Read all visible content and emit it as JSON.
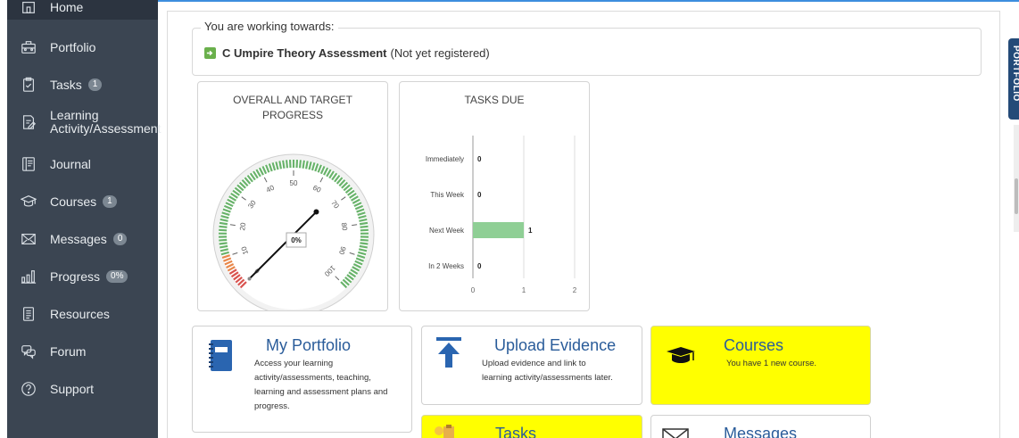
{
  "sidebar": {
    "items": [
      {
        "label": "Home",
        "icon": "home-icon",
        "badge": ""
      },
      {
        "label": "Portfolio",
        "icon": "briefcase-icon",
        "badge": ""
      },
      {
        "label": "Tasks",
        "icon": "clipboard-icon",
        "badge": "1"
      },
      {
        "label": "Learning",
        "label2": "Activity/Assessment",
        "icon": "edit-doc-icon",
        "badge": ""
      },
      {
        "label": "Journal",
        "icon": "journal-icon",
        "badge": ""
      },
      {
        "label": "Courses",
        "icon": "graduation-cap-icon",
        "badge": "1"
      },
      {
        "label": "Messages",
        "icon": "envelope-icon",
        "badge": "0"
      },
      {
        "label": "Progress",
        "icon": "bar-chart-icon",
        "badge": "0%"
      },
      {
        "label": "Resources",
        "icon": "resources-icon",
        "badge": ""
      },
      {
        "label": "Forum",
        "icon": "chat-icon",
        "badge": ""
      },
      {
        "label": "Support",
        "icon": "question-icon",
        "badge": ""
      }
    ]
  },
  "working": {
    "legend": "You are working towards:",
    "course": "C Umpire Theory Assessment",
    "status": "(Not yet registered)"
  },
  "right_tab": {
    "label": "PORTFOLIO"
  },
  "gauge": {
    "title_line1": "OVERALL AND TARGET",
    "title_line2": "PROGRESS",
    "value_label": "0%",
    "progress": 0,
    "ticks": [
      "0",
      "10",
      "20",
      "30",
      "40",
      "50",
      "60",
      "70",
      "80",
      "90",
      "100"
    ],
    "zone_colors": {
      "green": "#69b36b",
      "orange": "#e8874a",
      "red": "#d9534f"
    }
  },
  "tasks_due": {
    "title": "TASKS DUE"
  },
  "chart_data": {
    "type": "bar",
    "orientation": "horizontal",
    "title": "TASKS DUE",
    "categories": [
      "Immediately",
      "This Week",
      "Next Week",
      "In 2 Weeks"
    ],
    "values": [
      0,
      0,
      1,
      0
    ],
    "value_labels": [
      "0",
      "0",
      "1",
      "0"
    ],
    "xticks": [
      "0",
      "1",
      "2"
    ],
    "xlim": [
      0,
      2
    ],
    "bar_color": "#8fcf95",
    "grid": true
  },
  "tiles": [
    {
      "title": "My Portfolio",
      "icon": "notebook-icon",
      "desc": [
        "Access your learning",
        "activity/assessments, teaching,",
        "learning and assessment plans and",
        "progress."
      ]
    },
    {
      "title": "Upload Evidence",
      "icon": "upload-arrow-icon",
      "desc": [
        "Upload evidence and link to",
        "learning activity/assessments later."
      ]
    },
    {
      "title": "Courses",
      "icon": "graduation-cap-icon",
      "desc": [
        "You have 1 new course."
      ]
    },
    {
      "title": "Tasks",
      "icon": "tasks-icon",
      "desc": []
    },
    {
      "title": "Messages",
      "icon": "envelope-icon",
      "desc": []
    }
  ]
}
